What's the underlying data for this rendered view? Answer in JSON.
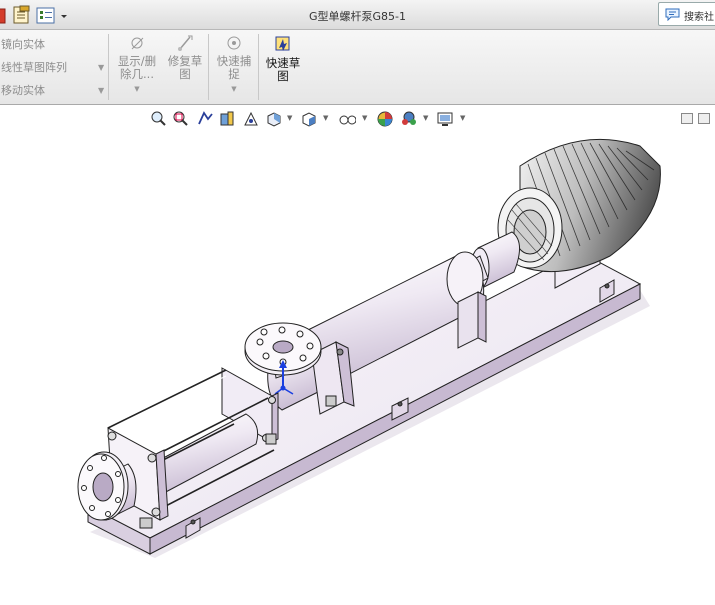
{
  "window": {
    "title": "G型单螺杆泵G85-1",
    "search_label": "搜索社"
  },
  "ribbon": {
    "list_items": [
      {
        "label": "镜向实体"
      },
      {
        "label": "线性草图阵列"
      },
      {
        "label": "移动实体"
      }
    ],
    "buttons": {
      "show_delete": "显示/删\n除几...",
      "repair_sketch": "修复草\n图",
      "quick_snap": "快速捕\n捉",
      "rapid_sketch": "快速草\n图"
    }
  },
  "heads_up_toolbar": {
    "icons": [
      "zoom-to-fit-icon",
      "zoom-to-area-icon",
      "previous-view-icon",
      "section-view-icon",
      "dynamic-annotation-icon",
      "view-orientation-icon",
      "display-style-icon",
      "hide-show-items-icon",
      "edit-appearance-icon",
      "apply-scene-icon",
      "view-settings-icon"
    ]
  },
  "colors": {
    "model_face": "#f3eff6",
    "model_shade": "#cfc3d8",
    "model_edge": "#222222",
    "triad_blue": "#1a3fe0"
  }
}
